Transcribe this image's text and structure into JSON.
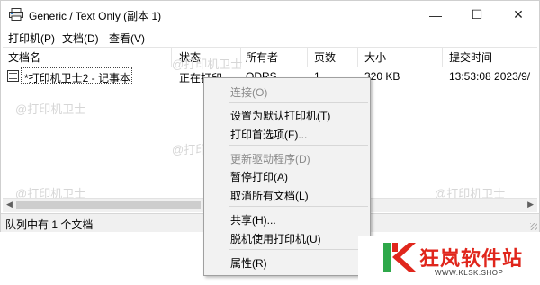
{
  "window": {
    "title": "Generic / Text Only (副本 1)",
    "minimize": "—",
    "maximize": "☐",
    "close": "✕"
  },
  "menubar": [
    "打印机(P)",
    "文档(D)",
    "查看(V)"
  ],
  "columns": [
    "文档名",
    "状态",
    "所有者",
    "页数",
    "大小",
    "提交时间"
  ],
  "rows": [
    {
      "name": "*打印机卫士2 - 记事本",
      "status": "正在打印",
      "owner": "ODRS",
      "pages": "1",
      "size": "320 KB",
      "time": "13:53:08  2023/9/"
    }
  ],
  "statusbar": "队列中有 1 个文档",
  "watermark": "@打印机卫士",
  "context_menu": [
    {
      "label": "连接(O)",
      "disabled": true
    },
    {
      "label": "设置为默认打印机(T)",
      "disabled": false
    },
    {
      "label": "打印首选项(F)...",
      "disabled": false
    },
    {
      "label": "更新驱动程序(D)",
      "disabled": true
    },
    {
      "label": "暂停打印(A)",
      "disabled": false
    },
    {
      "label": "取消所有文档(L)",
      "disabled": false
    },
    {
      "label": "共享(H)...",
      "disabled": false
    },
    {
      "label": "脱机使用打印机(U)",
      "disabled": false
    },
    {
      "label": "属性(R)",
      "disabled": false
    }
  ],
  "logo": {
    "text": "狂岚软件站",
    "url": "WWW.KLSK.SHOP"
  },
  "colors": {
    "logo_red": "#e0261c",
    "logo_green": "#2ea84a",
    "menu_bg": "#f2f2f2"
  }
}
